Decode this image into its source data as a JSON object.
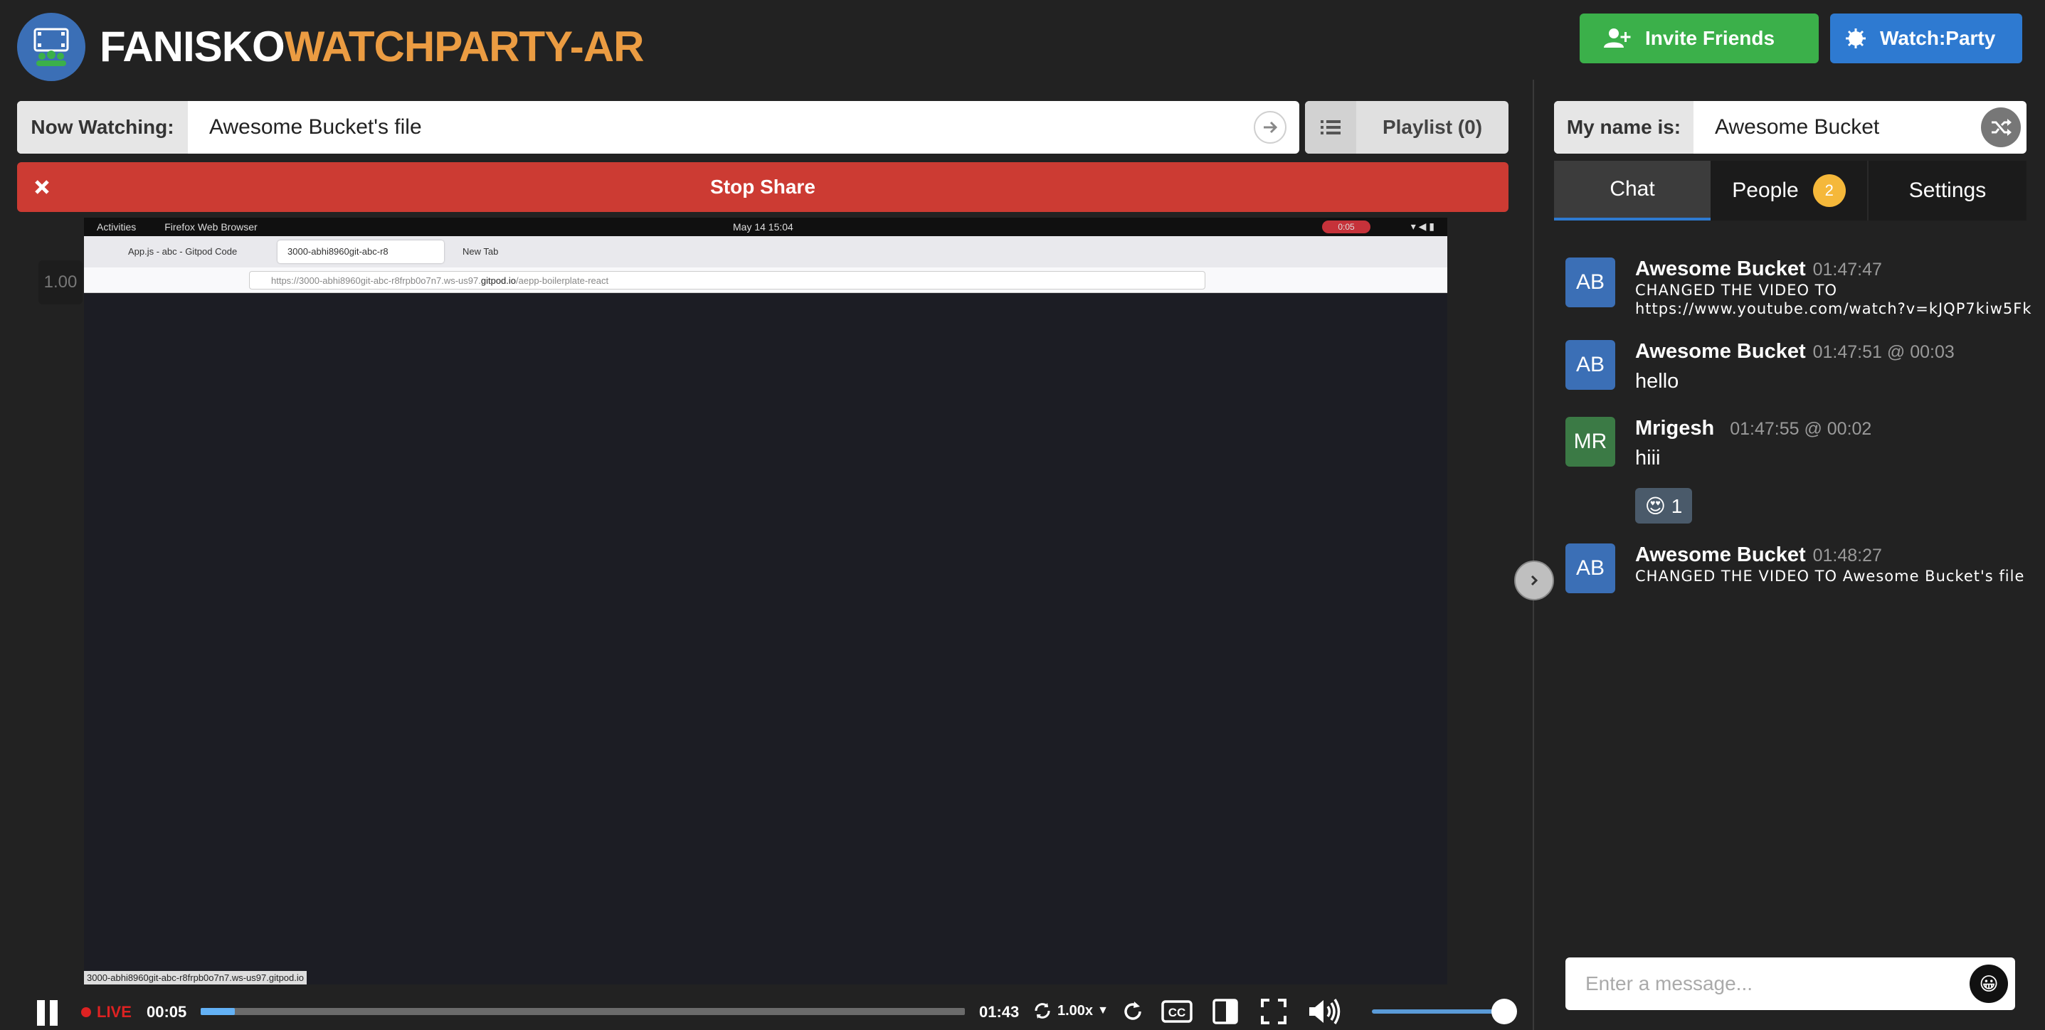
{
  "header": {
    "brand_part1": "FANISKO",
    "brand_part2": "WATCHPARTY-AR",
    "invite_label": "Invite Friends",
    "watchparty_label": "Watch:Party"
  },
  "now_watching": {
    "label": "Now Watching:",
    "value": "Awesome Bucket's file"
  },
  "playlist": {
    "label": "Playlist (0)"
  },
  "stop_share": {
    "label": "Stop Share"
  },
  "video": {
    "rate_badge": "1.00",
    "gnome_bar": {
      "activities": "Activities",
      "app": "Firefox Web Browser",
      "clock": "May 14  15:04",
      "record": "0:05"
    },
    "browser_tabs": [
      "App.js - abc - Gitpod Code",
      "3000-abhi8960git-abc-r8",
      "New Tab"
    ],
    "url_prefix": "https://3000-abhi8960git-abc-r8frpb0o7n7.ws-us97.",
    "url_domain": "gitpod.io",
    "url_path": "/aepp-boilerplate-react",
    "status_url": "3000-abhi8960git-abc-r8frpb0o7n7.ws-us97.gitpod.io"
  },
  "player": {
    "live_label": "LIVE",
    "current_time": "00:05",
    "duration": "01:43",
    "speed": "1.00x",
    "progress_pct": 4.5,
    "volume_pct": 100
  },
  "sidebar": {
    "name_label": "My name is:",
    "name_value": "Awesome Bucket",
    "tabs": [
      {
        "label": "Chat"
      },
      {
        "label": "People",
        "badge": "2"
      },
      {
        "label": "Settings"
      }
    ],
    "messages": [
      {
        "initials": "AB",
        "name": "Awesome Bucket",
        "time": "01:47:47",
        "system_line1": "CHANGED THE VIDEO TO",
        "system_line2": "https://www.youtube.com/watch?v=kJQP7kiw5Fk",
        "avatar_color": "#3b6fb6"
      },
      {
        "initials": "AB",
        "name": "Awesome Bucket",
        "time": "01:47:51 @ 00:03",
        "text": "hello",
        "avatar_color": "#3b6fb6"
      },
      {
        "initials": "MR",
        "name": "Mrigesh",
        "time": "01:47:55 @ 00:02",
        "text": "hiii",
        "reaction": "😍 1",
        "avatar_color": "#3b7a45"
      },
      {
        "initials": "AB",
        "name": "Awesome Bucket",
        "time": "01:48:27",
        "system_line1": "CHANGED THE VIDEO TO Awesome Bucket's file",
        "avatar_color": "#3b6fb6"
      }
    ],
    "input_placeholder": "Enter a message...",
    "emoji_icon": "😀"
  },
  "colors": {
    "brand_orange": "#eb9c42",
    "invite_green": "#3bb04a",
    "watchparty_blue": "#2e7ad1",
    "stop_red": "#cc3b33",
    "badge_yellow": "#f5b83a"
  }
}
